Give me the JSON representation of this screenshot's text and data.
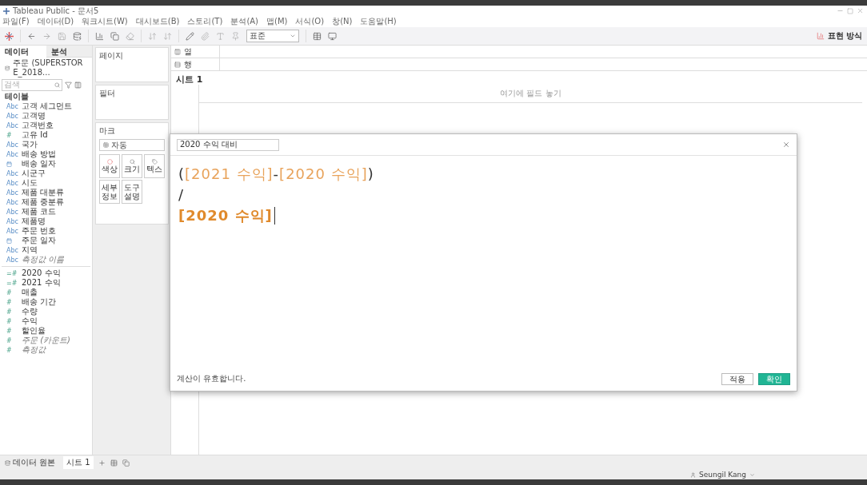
{
  "window": {
    "title": "Tableau Public - 문서5"
  },
  "menu": [
    "파일(F)",
    "데이터(D)",
    "워크시트(W)",
    "대시보드(B)",
    "스토리(T)",
    "분석(A)",
    "맵(M)",
    "서식(O)",
    "창(N)",
    "도움말(H)"
  ],
  "toolbar": {
    "fit_select": "표준",
    "show_me": "표현 방식"
  },
  "data_pane": {
    "tabs": [
      {
        "label": "데이터",
        "selected": true
      },
      {
        "label": "분석",
        "selected": false
      }
    ],
    "source": "주문 (SUPERSTORE_2018...",
    "search": {
      "placeholder": "검색"
    },
    "section": "테이블",
    "fields": [
      {
        "kind": "string",
        "badge": "Abc",
        "name": "고객 세그먼트",
        "italic": false
      },
      {
        "kind": "string",
        "badge": "Abc",
        "name": "고객명",
        "italic": false
      },
      {
        "kind": "string",
        "badge": "Abc",
        "name": "고객번호",
        "italic": false
      },
      {
        "kind": "number",
        "badge": "#",
        "name": "고유 Id",
        "italic": false
      },
      {
        "kind": "string",
        "badge": "Abc",
        "name": "국가",
        "italic": false
      },
      {
        "kind": "string",
        "badge": "Abc",
        "name": "배송 방법",
        "italic": false
      },
      {
        "kind": "date",
        "name": "배송 일자",
        "italic": false
      },
      {
        "kind": "string",
        "badge": "Abc",
        "name": "시군구",
        "italic": false
      },
      {
        "kind": "string",
        "badge": "Abc",
        "name": "시도",
        "italic": false
      },
      {
        "kind": "string",
        "badge": "Abc",
        "name": "제품 대분류",
        "italic": false
      },
      {
        "kind": "string",
        "badge": "Abc",
        "name": "제품 중분류",
        "italic": false
      },
      {
        "kind": "string",
        "badge": "Abc",
        "name": "제품 코드",
        "italic": false
      },
      {
        "kind": "string",
        "badge": "Abc",
        "name": "제품명",
        "italic": false
      },
      {
        "kind": "string",
        "badge": "Abc",
        "name": "주문 번호",
        "italic": false
      },
      {
        "kind": "date",
        "name": "주문 일자",
        "italic": false
      },
      {
        "kind": "string",
        "badge": "Abc",
        "name": "지역",
        "italic": false
      },
      {
        "kind": "string",
        "badge": "Abc",
        "name": "측정값 이름",
        "italic": true
      },
      {
        "kind": "divider"
      },
      {
        "kind": "calc",
        "badge": "=#",
        "name": "2020 수익",
        "italic": false
      },
      {
        "kind": "calc",
        "badge": "=#",
        "name": "2021 수익",
        "italic": false
      },
      {
        "kind": "measure",
        "badge": "#",
        "name": "매출",
        "italic": false
      },
      {
        "kind": "measure",
        "badge": "#",
        "name": "배송 기간",
        "italic": false
      },
      {
        "kind": "measure",
        "badge": "#",
        "name": "수량",
        "italic": false
      },
      {
        "kind": "measure",
        "badge": "#",
        "name": "수익",
        "italic": false
      },
      {
        "kind": "measure",
        "badge": "#",
        "name": "할인율",
        "italic": false
      },
      {
        "kind": "measure",
        "badge": "#",
        "name": "주문 (카운트)",
        "italic": true
      },
      {
        "kind": "measure",
        "badge": "#",
        "name": "측정값",
        "italic": true
      }
    ]
  },
  "shelves": {
    "pages": "페이지",
    "filters": "필터",
    "marks": "마크",
    "mark_type": "자동",
    "mark_buttons": [
      {
        "kind": "color",
        "label": "색상"
      },
      {
        "kind": "size",
        "label": "크기"
      },
      {
        "kind": "text",
        "label": "텍스"
      },
      {
        "kind": "plain",
        "label": "세부\n정보"
      },
      {
        "kind": "plain",
        "label": "도구\n설명"
      }
    ],
    "columns": "열",
    "rows": "행"
  },
  "sheet": {
    "title": "시트 1",
    "drop_hint": "여기에 필드 놓기"
  },
  "calc_dialog": {
    "name": "2020 수익 대비",
    "formula": [
      [
        {
          "kind": "op",
          "text": "("
        },
        {
          "kind": "field",
          "text": "[2021 수익]"
        },
        {
          "kind": "op",
          "text": "-"
        },
        {
          "kind": "field",
          "text": "[2020 수익]"
        },
        {
          "kind": "op",
          "text": ")"
        }
      ],
      [
        {
          "kind": "op",
          "text": "/"
        }
      ],
      [
        {
          "kind": "field_strong",
          "text": "[2020 수익]"
        }
      ]
    ],
    "status": "계산이 유효합니다.",
    "apply": "적용",
    "ok": "확인"
  },
  "bottom_tabs": [
    {
      "kind": "source",
      "label": "데이터 원본",
      "selected": false
    },
    {
      "kind": "sheet",
      "label": "시트 1",
      "selected": true
    }
  ],
  "status_bar": {
    "user": "Seungil Kang"
  }
}
